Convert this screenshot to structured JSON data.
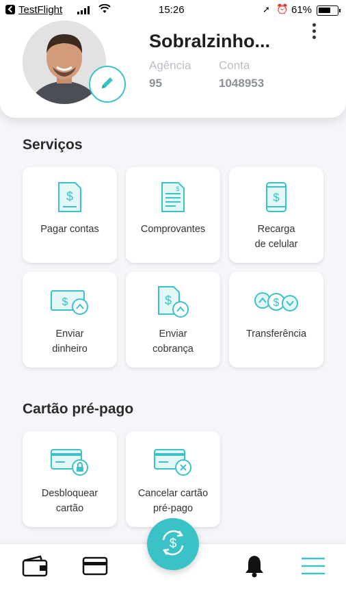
{
  "status_bar": {
    "app": "TestFlight",
    "time": "15:26",
    "battery": "61%"
  },
  "profile": {
    "name": "Sobralzinho...",
    "agencia_label": "Agência",
    "agencia_value": "95",
    "conta_label": "Conta",
    "conta_value": "1048953"
  },
  "services": {
    "title": "Serviços",
    "items": [
      {
        "label": "Pagar contas",
        "icon": "bill-icon"
      },
      {
        "label": "Comprovantes",
        "icon": "receipt-icon"
      },
      {
        "label": "Recarga\nde celular",
        "icon": "phone-recharge-icon"
      },
      {
        "label": "Enviar\ndinheiro",
        "icon": "send-money-icon"
      },
      {
        "label": "Enviar\ncobrança",
        "icon": "send-charge-icon"
      },
      {
        "label": "Transferência",
        "icon": "transfer-icon"
      }
    ]
  },
  "prepaid": {
    "title": "Cartão pré-pago",
    "items": [
      {
        "label": "Desbloquear\ncartão",
        "icon": "card-unlock-icon"
      },
      {
        "label": "Cancelar cartão\npré-pago",
        "icon": "card-cancel-icon"
      }
    ]
  },
  "nav": {
    "items": [
      "wallet-icon",
      "card-icon",
      "bell-icon",
      "menu-icon"
    ],
    "fab": "exchange-money-icon"
  },
  "colors": {
    "accent": "#3bc2c6",
    "background": "#f4f6f9"
  }
}
